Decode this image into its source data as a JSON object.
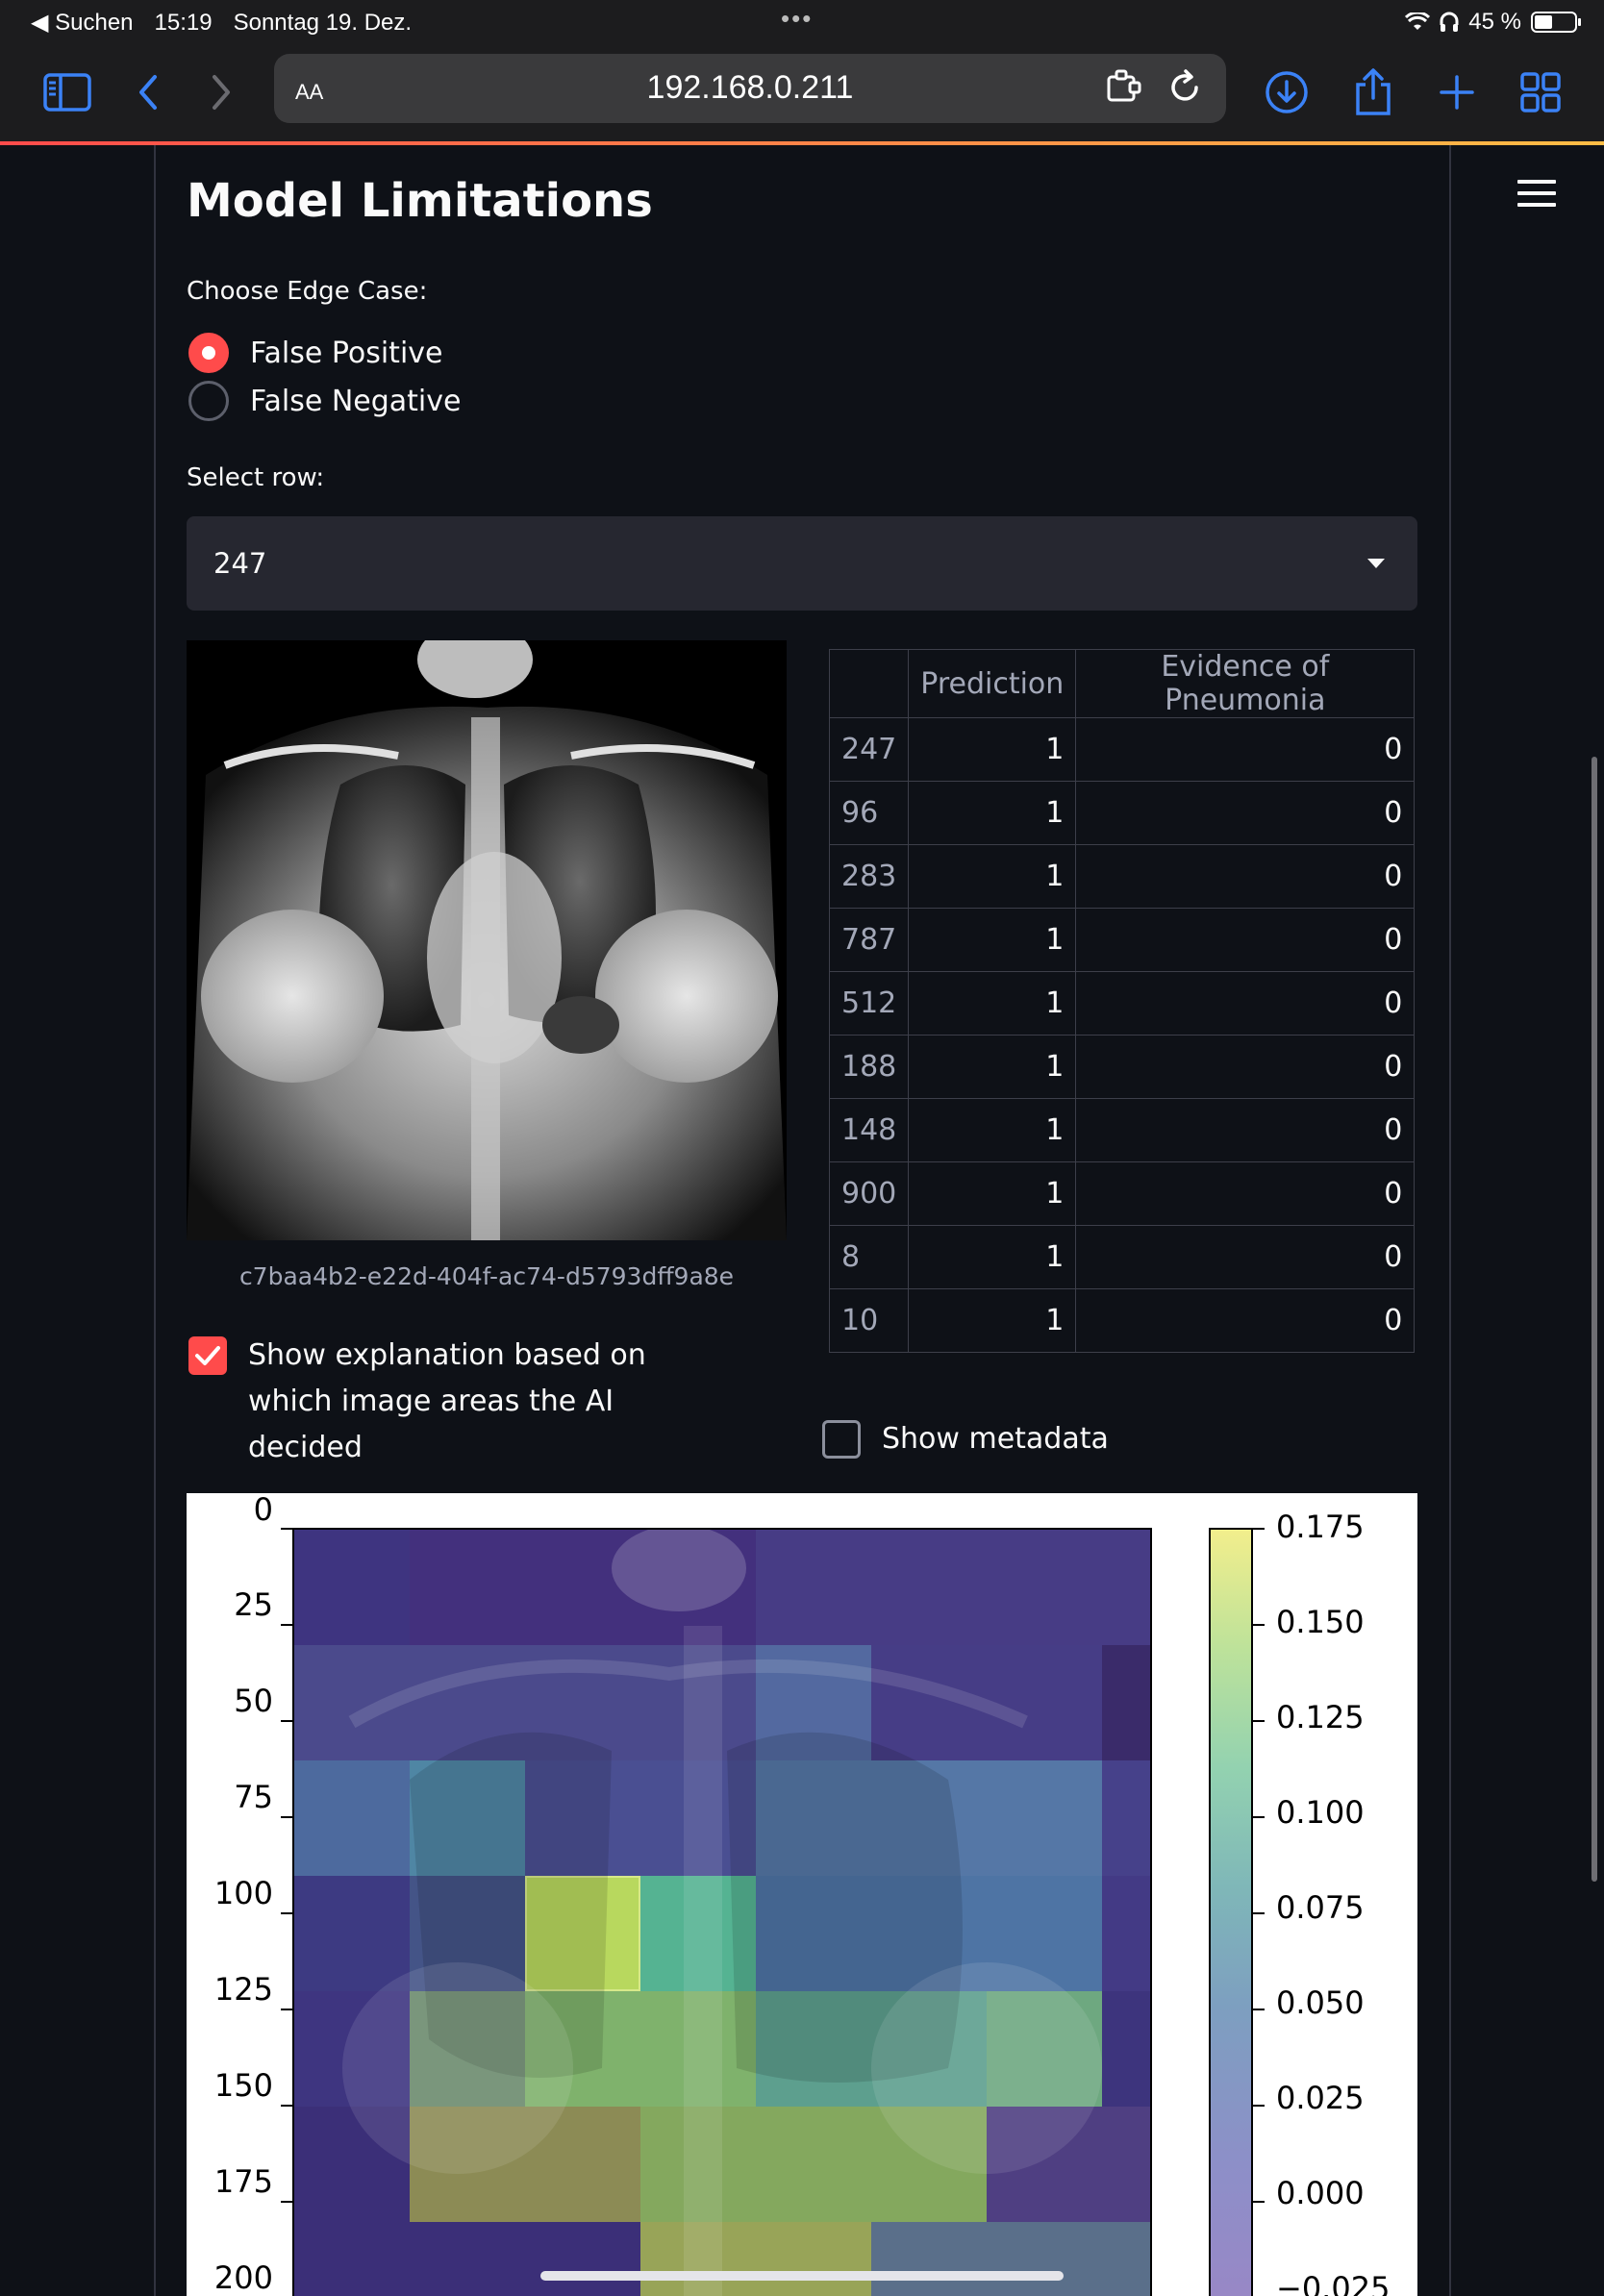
{
  "status_bar": {
    "back_app": "◀ Suchen",
    "time": "15:19",
    "date": "Sonntag 19. Dez.",
    "battery": "45 %"
  },
  "browser": {
    "aa_label": "AA",
    "url": "192.168.0.211"
  },
  "page": {
    "title": "Model Limitations",
    "edge_case_label": "Choose Edge Case:",
    "edge_case_options": [
      "False Positive",
      "False Negative"
    ],
    "edge_case_selected": "False Positive",
    "row_label": "Select row:",
    "row_selected": "247",
    "image_caption": "c7baa4b2-e22d-404f-ac74-d5793dff9a8e",
    "explain_label": "Show explanation based on which image areas the AI decided",
    "explain_checked": true,
    "metadata_label": "Show metadata",
    "metadata_checked": false
  },
  "table": {
    "columns": [
      "",
      "Prediction",
      "Evidence of Pneumonia"
    ],
    "rows": [
      [
        "247",
        "1",
        "0"
      ],
      [
        "96",
        "1",
        "0"
      ],
      [
        "283",
        "1",
        "0"
      ],
      [
        "787",
        "1",
        "0"
      ],
      [
        "512",
        "1",
        "0"
      ],
      [
        "188",
        "1",
        "0"
      ],
      [
        "148",
        "1",
        "0"
      ],
      [
        "900",
        "1",
        "0"
      ],
      [
        "8",
        "1",
        "0"
      ],
      [
        "10",
        "1",
        "0"
      ]
    ]
  },
  "heatmap": {
    "y_ticks": [
      "0",
      "25",
      "50",
      "75",
      "100",
      "125",
      "150",
      "175",
      "200"
    ],
    "colorbar_ticks": [
      "0.175",
      "0.150",
      "0.125",
      "0.100",
      "0.075",
      "0.050",
      "0.025",
      "0.000",
      "−0.025"
    ]
  }
}
